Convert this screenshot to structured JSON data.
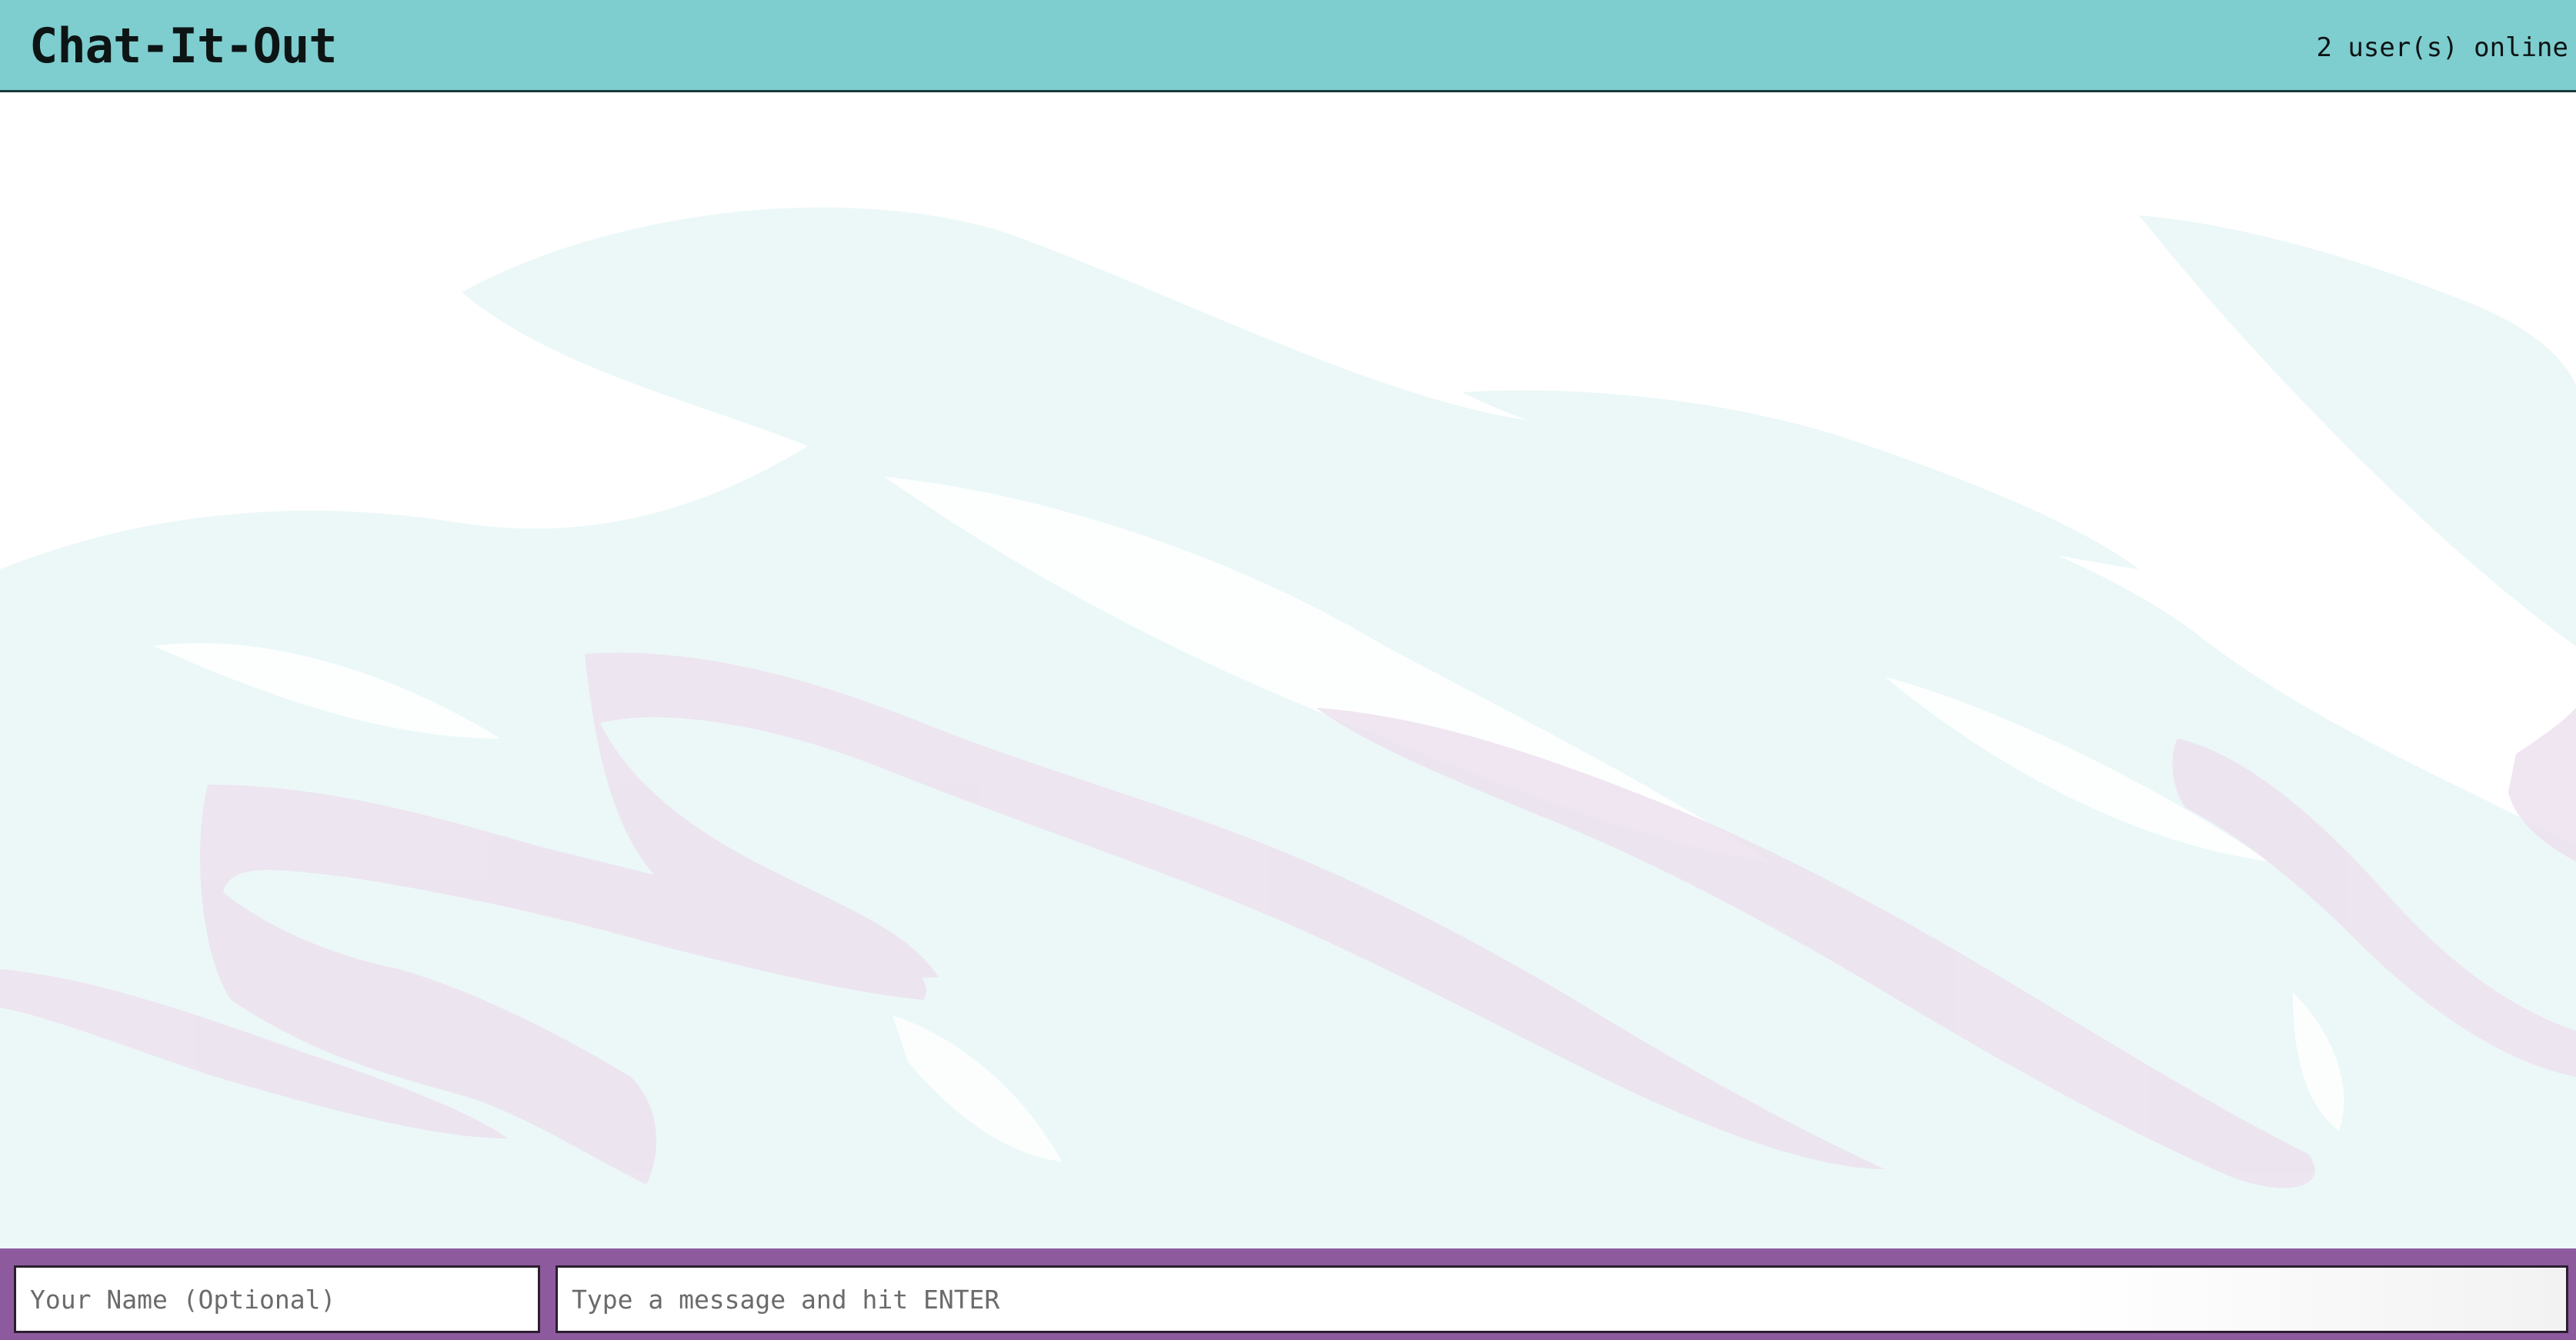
{
  "header": {
    "title": "Chat-It-Out",
    "online_status": "2 user(s) online"
  },
  "messages": {
    "items": []
  },
  "composer": {
    "name_placeholder": "Your Name (Optional)",
    "name_value": "",
    "message_placeholder": "Type a message and hit ENTER",
    "message_value": ""
  },
  "colors": {
    "header_bg": "#7ecdcf",
    "footer_bg": "#8e5a9e",
    "background_pattern_teal": "#e6f5f5",
    "background_pattern_purple": "#ede2ef"
  }
}
